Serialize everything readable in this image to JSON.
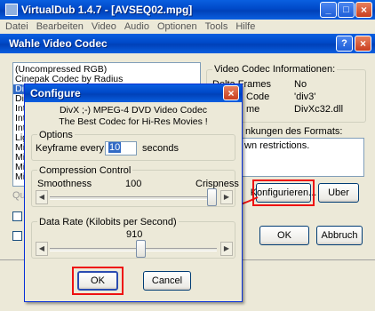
{
  "vdub": {
    "title": "VirtualDub 1.4.7 - [AVSEQ02.mpg]",
    "menu": [
      "Datei",
      "Bearbeiten",
      "Video",
      "Audio",
      "Optionen",
      "Tools",
      "Hilfe"
    ]
  },
  "codec_window": {
    "title": "Wahle Video Codec",
    "codec_list": [
      "(Uncompressed RGB)",
      "Cinepak Codec by Radius",
      "Div",
      "Div",
      "Inte",
      "Inte",
      "Inte",
      "Lig",
      "Mic",
      "Mic",
      "Mic",
      "Mic"
    ],
    "selected_index": 2,
    "quality_label": "Qua",
    "info_group": "Video Codec Informationen:",
    "info_rows": [
      {
        "label": "Delta Frames",
        "value": "No"
      },
      {
        "label": "Code",
        "value": "'div3'"
      },
      {
        "label": "me",
        "value": "DivXc32.dll"
      }
    ],
    "restrictions_group": "nkungen des Formats:",
    "restrictions_text": "wn restrictions.",
    "configure_button": "Konfigurieren...",
    "about_button": "Uber",
    "ok_button": "OK",
    "cancel_button": "Abbruch"
  },
  "configure": {
    "title": "Configure",
    "header_line1": "DivX ;-) MPEG-4 DVD Video Codec",
    "header_line2": "The Best Codec for Hi-Res Movies !",
    "options_group": "Options",
    "keyframe_label": "Keyframe every",
    "keyframe_value": "10",
    "seconds_label": "seconds",
    "compression_group": "Compression Control",
    "smoothness_label": "Smoothness",
    "compression_value": "100",
    "crispness_label": "Crispness",
    "compression_level": 1.0,
    "datarate_group": "Data Rate (Kilobits per Second)",
    "datarate_value": "910",
    "datarate_level": 0.55,
    "ok_button": "OK",
    "cancel_button": "Cancel"
  }
}
